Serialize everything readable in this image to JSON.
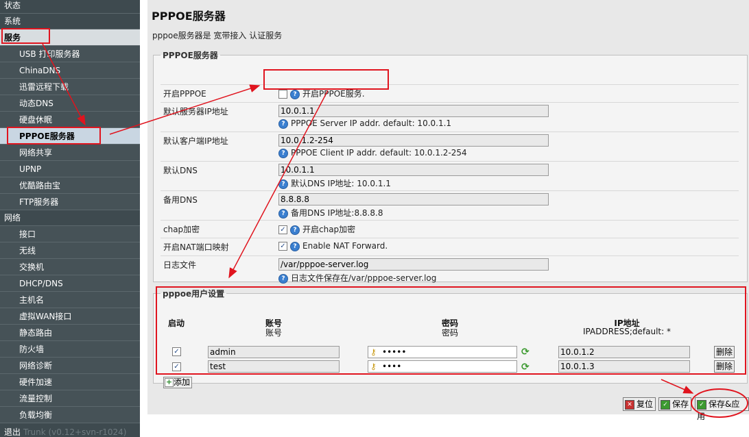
{
  "sidebar": {
    "categories": {
      "status": "状态",
      "system": "系统",
      "services": "服务",
      "network": "网络",
      "logout": "退出"
    },
    "service_items": [
      "USB 打印服务器",
      "ChinaDNS",
      "迅雷远程下载",
      "动态DNS",
      "硬盘休眠",
      "PPPOE服务器",
      "网络共享",
      "UPNP",
      "优酷路由宝",
      "FTP服务器"
    ],
    "network_items": [
      "接口",
      "无线",
      "交换机",
      "DHCP/DNS",
      "主机名",
      "虚拟WAN接口",
      "静态路由",
      "防火墙",
      "网络诊断",
      "硬件加速",
      "流量控制",
      "负载均衡"
    ],
    "version": "Trunk (v0.12+svn-r1024)"
  },
  "page": {
    "title": "PPPOE服务器",
    "description": "pppoe服务器是 宽带接入 认证服务"
  },
  "server_section": {
    "legend": "PPPOE服务器",
    "enable": {
      "label": "开启PPPOE",
      "hint": "开启PPPOE服务.",
      "checked": false
    },
    "server_ip": {
      "label": "默认服务器IP地址",
      "value": "10.0.1.1",
      "hint": "PPPOE Server IP addr. default: 10.0.1.1"
    },
    "client_ip": {
      "label": "默认客户端IP地址",
      "value": "10.0.1.2-254",
      "hint": "PPPOE Client IP addr. default: 10.0.1.2-254"
    },
    "dns1": {
      "label": "默认DNS",
      "value": "10.0.1.1",
      "hint": "默认DNS IP地址: 10.0.1.1"
    },
    "dns2": {
      "label": "备用DNS",
      "value": "8.8.8.8",
      "hint": "备用DNS IP地址:8.8.8.8"
    },
    "chap": {
      "label": "chap加密",
      "hint": "开启chap加密",
      "checked": true
    },
    "nat": {
      "label": "开启NAT端口映射",
      "hint": "Enable NAT Forward.",
      "checked": true
    },
    "log": {
      "label": "日志文件",
      "value": "/var/pppoe-server.log",
      "hint": "日志文件保存在/var/pppoe-server.log"
    }
  },
  "users_section": {
    "legend": "pppoe用户设置",
    "headers": {
      "enable": "启动",
      "account": "账号",
      "account_sub": "账号",
      "password": "密码",
      "password_sub": "密码",
      "ip": "IP地址",
      "ip_sub": "IPADDRESS;default: *"
    },
    "rows": [
      {
        "enabled": true,
        "account": "admin",
        "password": "•••••",
        "ip": "10.0.1.2",
        "delete": "删除"
      },
      {
        "enabled": true,
        "account": "test",
        "password": "••••",
        "ip": "10.0.1.3",
        "delete": "删除"
      }
    ],
    "add_label": "添加"
  },
  "buttons": {
    "reset": "复位",
    "save": "保存",
    "save_apply": "保存&应用"
  },
  "colors": {
    "sidebar_bg": "#3e4a4f",
    "annotation_red": "#e0141e",
    "help_blue": "#3a7fd0"
  }
}
